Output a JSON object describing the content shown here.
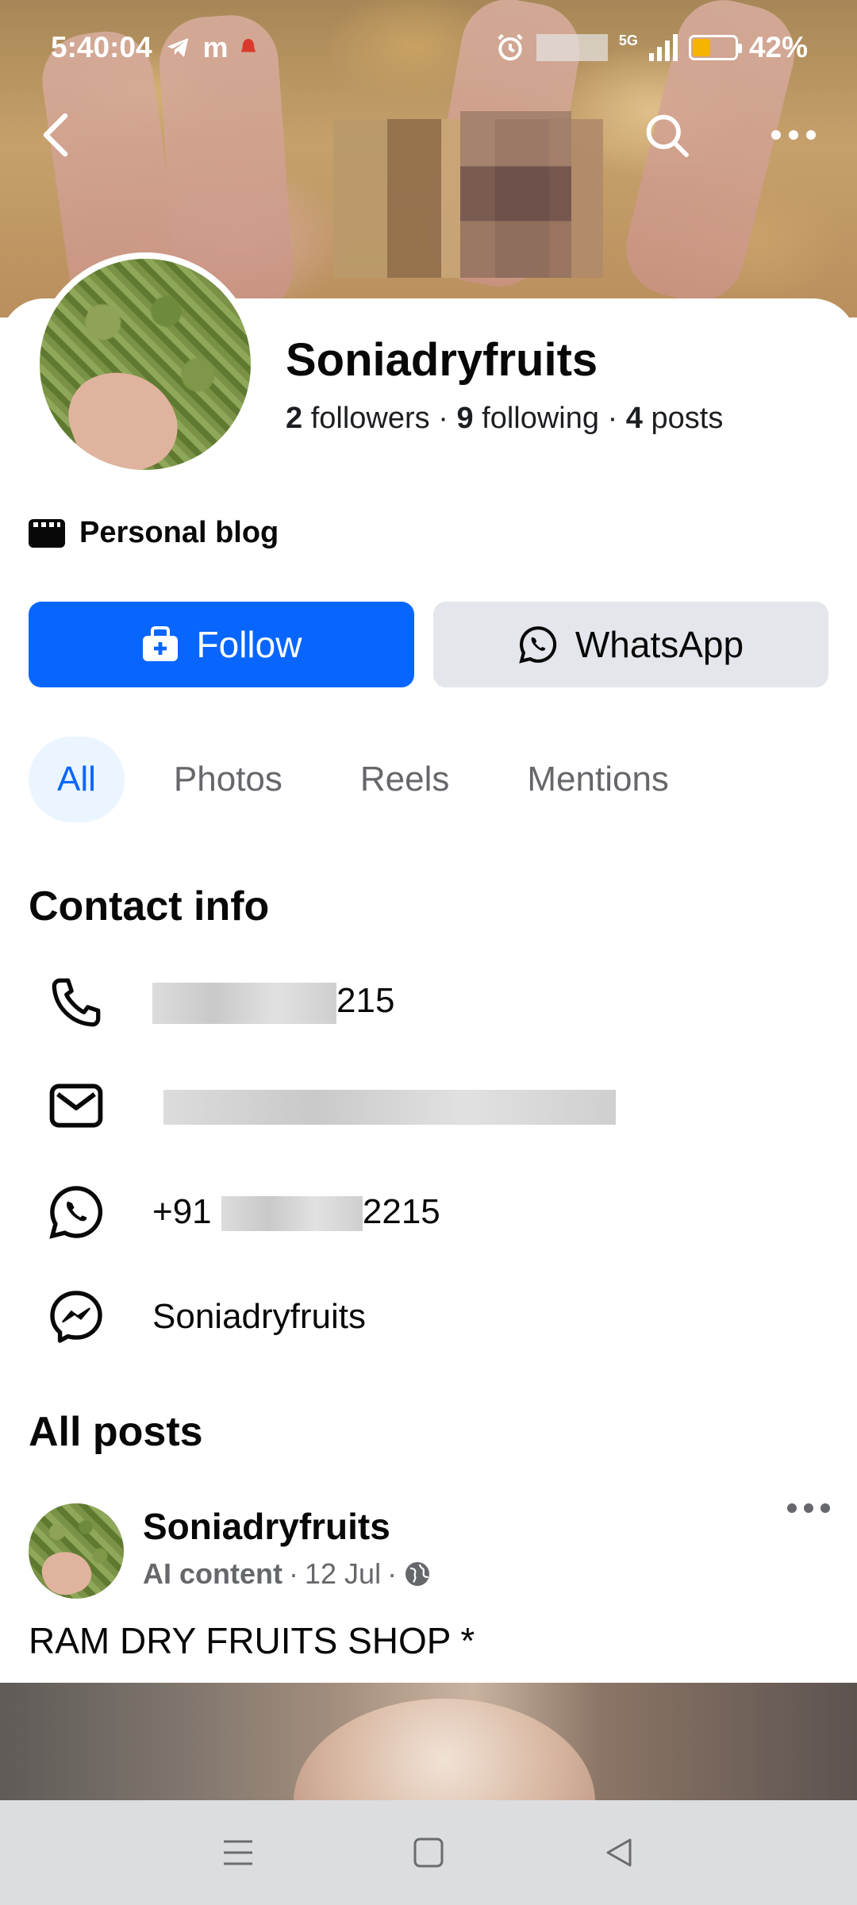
{
  "status_bar": {
    "time": "5:40:04",
    "network": "5G",
    "battery": "42%",
    "battery_level": 0.42
  },
  "profile": {
    "name": "Soniadryfruits",
    "followers_count": "2",
    "followers_label": "followers",
    "following_count": "9",
    "following_label": "following",
    "posts_count": "4",
    "posts_label": "posts",
    "separator": "·",
    "category": "Personal blog"
  },
  "actions": {
    "follow_label": "Follow",
    "whatsapp_label": "WhatsApp"
  },
  "tabs": [
    {
      "label": "All",
      "active": true
    },
    {
      "label": "Photos",
      "active": false
    },
    {
      "label": "Reels",
      "active": false
    },
    {
      "label": "Mentions",
      "active": false
    }
  ],
  "contact_info": {
    "title": "Contact info",
    "phone_visible": "215",
    "whatsapp_prefix": "+91",
    "whatsapp_visible": "2215",
    "messenger": "Soniadryfruits"
  },
  "all_posts": {
    "title": "All posts",
    "post": {
      "author": "Soniadryfruits",
      "label": "AI content",
      "date": "12 Jul",
      "separator": "·",
      "text": "RAM DRY FRUITS SHOP *"
    }
  },
  "colors": {
    "primary": "#0866ff",
    "secondary_button": "#e4e6eb",
    "active_tab_bg": "#ebf5ff",
    "muted_text": "#65676b",
    "battery_fill": "#f5b400"
  },
  "icons": {
    "back": "back-arrow-icon",
    "search": "search-icon",
    "more": "more-icon",
    "follow": "follow-user-icon",
    "whatsapp": "whatsapp-icon",
    "phone": "phone-icon",
    "email": "email-icon",
    "messenger": "messenger-icon",
    "globe": "globe-icon"
  }
}
